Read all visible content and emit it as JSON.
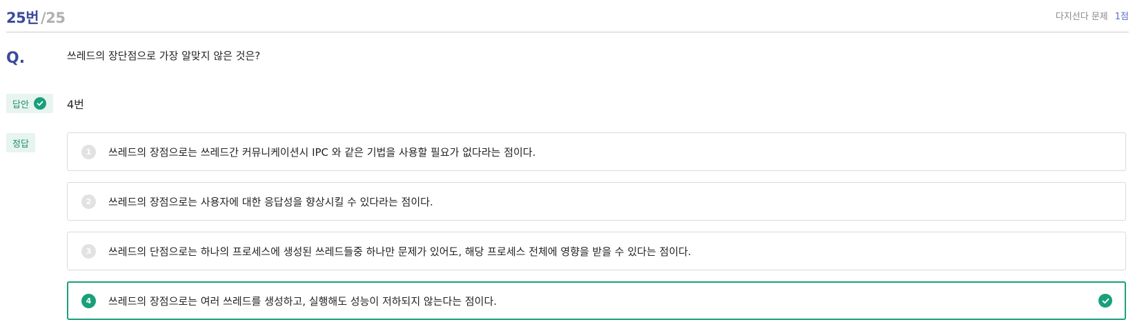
{
  "header": {
    "question_number": "25번",
    "question_total": "/25",
    "question_type": "다지선다 문제",
    "points": "1점"
  },
  "question": {
    "label": "Q.",
    "text": "쓰레드의 장단점으로 가장 알맞지 않은 것은?"
  },
  "answer": {
    "badge_label": "답안",
    "value": "4번"
  },
  "correct": {
    "badge_label": "정답"
  },
  "options": [
    {
      "number": "1",
      "text": "쓰레드의 장점으로는 쓰레드간 커뮤니케이션시 IPC 와 같은 기법을 사용할 필요가 없다라는 점이다.",
      "selected": false
    },
    {
      "number": "2",
      "text": "쓰레드의 장점으로는 사용자에 대한 응답성을 향상시킬 수 있다라는 점이다.",
      "selected": false
    },
    {
      "number": "3",
      "text": "쓰레드의 단점으로는 하나의 프로세스에 생성된 쓰레드들중 하나만 문제가 있어도, 해당 프로세스 전체에 영향을 받을 수 있다는 점이다.",
      "selected": false
    },
    {
      "number": "4",
      "text": "쓰레드의 장점으로는 여러 쓰레드를 생성하고, 실행해도 성능이 저하되지 않는다는 점이다.",
      "selected": true
    }
  ],
  "colors": {
    "accent_navy": "#3b4a9c",
    "accent_green": "#17a079",
    "badge_bg": "#e7f4ef"
  }
}
